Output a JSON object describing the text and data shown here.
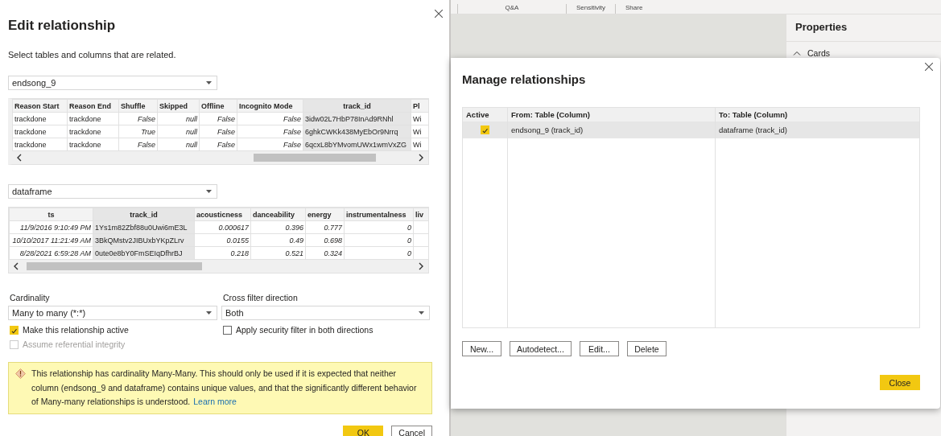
{
  "edit_dialog": {
    "title": "Edit relationship",
    "subtitle": "Select tables and columns that are related.",
    "tables": [
      {
        "name": "endsong_9",
        "columns": [
          {
            "label": "Reason Start",
            "kind": "text",
            "selected": false
          },
          {
            "label": "Reason End",
            "kind": "text",
            "selected": false
          },
          {
            "label": "Shuffle",
            "kind": "value",
            "selected": false
          },
          {
            "label": "Skipped",
            "kind": "value",
            "selected": false
          },
          {
            "label": "Offline",
            "kind": "value",
            "selected": false
          },
          {
            "label": "Incognito Mode",
            "kind": "value",
            "selected": false
          },
          {
            "label": "track_id",
            "kind": "text",
            "selected": true
          },
          {
            "label": "Pl",
            "kind": "text",
            "selected": false
          }
        ],
        "rows": [
          [
            "trackdone",
            "trackdone",
            "False",
            "null",
            "False",
            "False",
            "3idw02L7HbP78InAd9RNhl",
            "Wi"
          ],
          [
            "trackdone",
            "trackdone",
            "True",
            "null",
            "False",
            "False",
            "6ghkCWKk438MyEbOr9Nrrq",
            "Wi"
          ],
          [
            "trackdone",
            "trackdone",
            "False",
            "null",
            "False",
            "False",
            "6qcxL8bYMvomUWx1wmVxZG",
            "Wi"
          ]
        ]
      },
      {
        "name": "dataframe",
        "columns": [
          {
            "label": "ts",
            "kind": "value",
            "selected": false
          },
          {
            "label": "track_id",
            "kind": "text",
            "selected": true
          },
          {
            "label": "acousticness",
            "kind": "value",
            "selected": false
          },
          {
            "label": "danceability",
            "kind": "value",
            "selected": false
          },
          {
            "label": "energy",
            "kind": "value",
            "selected": false
          },
          {
            "label": "instrumentalness",
            "kind": "value",
            "selected": false
          },
          {
            "label": "liv",
            "kind": "value",
            "selected": false
          }
        ],
        "rows": [
          [
            "11/9/2016 9:10:49 PM",
            "1Ys1m82Zbf88u0Uwi6mE3L",
            "0.000617",
            "0.396",
            "0.777",
            "0",
            ""
          ],
          [
            "10/10/2017 11:21:49 AM",
            "3BkQMstv2JIBUxbYKpZLrv",
            "0.0155",
            "0.49",
            "0.698",
            "0",
            ""
          ],
          [
            "8/28/2021 6:59:28 AM",
            "0ute0e8bY0FmSEIqDfhrBJ",
            "0.218",
            "0.521",
            "0.324",
            "0",
            ""
          ]
        ]
      }
    ],
    "cardinality": {
      "label": "Cardinality",
      "value": "Many to many (*:*)"
    },
    "cross_filter": {
      "label": "Cross filter direction",
      "value": "Both"
    },
    "checkboxes": [
      {
        "label": "Make this relationship active",
        "checked": true,
        "disabled": false
      },
      {
        "label": "Apply security filter in both directions",
        "checked": false,
        "disabled": false
      },
      {
        "label": "Assume referential integrity",
        "checked": false,
        "disabled": true
      }
    ],
    "warning": {
      "text": "This relationship has cardinality Many-Many. This should only be used if it is expected that neither column (endsong_9 and dataframe) contains unique values, and that the significantly different behavior of Many-many relationships is understood.",
      "link": "Learn more"
    },
    "buttons": [
      {
        "label": "OK",
        "kind": "primary"
      },
      {
        "label": "Cancel",
        "kind": "secondary"
      }
    ]
  },
  "ribbon": {
    "tabs": [
      "Q&A",
      "Sensitivity",
      "Share"
    ]
  },
  "properties": {
    "title": "Properties",
    "sections": [
      {
        "label": "Cards",
        "expanded": true
      }
    ]
  },
  "manage_dialog": {
    "title": "Manage relationships",
    "columns": [
      "Active",
      "From: Table (Column)",
      "To: Table (Column)"
    ],
    "rows": [
      {
        "active": true,
        "from": "endsong_9 (track_id)",
        "to": "dataframe (track_id)",
        "selected": true
      }
    ],
    "buttons": [
      "New...",
      "Autodetect...",
      "Edit...",
      "Delete"
    ],
    "close": "Close"
  }
}
